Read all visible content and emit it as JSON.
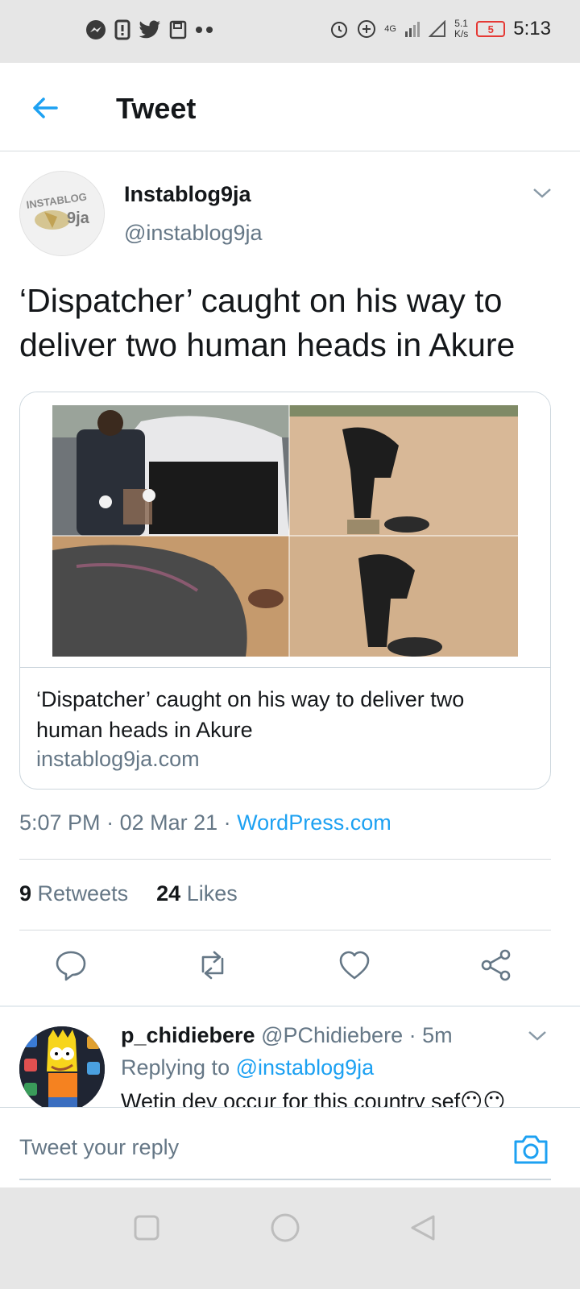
{
  "status_bar": {
    "time": "5:13",
    "speed_value": "5.1",
    "speed_unit": "K/s",
    "network": "4G",
    "battery": "5",
    "left_icons": [
      "messenger-icon",
      "notification-icon",
      "twitter-bird-icon",
      "save-icon",
      "more-dots-icon"
    ],
    "right_icons": [
      "alarm-icon",
      "data-saver-icon",
      "signal-icon",
      "wifi-signal-icon"
    ]
  },
  "header": {
    "title": "Tweet"
  },
  "tweet": {
    "author_name": "Instablog9ja",
    "author_handle": "@instablog9ja",
    "avatar_text": "INSTABLOG 9ja",
    "text": "‘Dispatcher’ caught on his way to deliver two human heads in Akure",
    "card": {
      "title": "‘Dispatcher’ caught on his way to deliver two human heads in Akure",
      "domain": "instablog9ja.com"
    },
    "time": "5:07 PM",
    "date": "02 Mar 21",
    "source": "WordPress.com",
    "retweets_count": "9",
    "retweets_label": "Retweets",
    "likes_count": "24",
    "likes_label": "Likes"
  },
  "reply": {
    "name": "p_chidiebere",
    "handle": "@PChidiebere",
    "age": "5m",
    "replying_prefix": "Replying to",
    "replying_to": "@instablog9ja",
    "text": "Wetin dey occur for this country sef😶😶"
  },
  "compose": {
    "placeholder": "Tweet your reply"
  },
  "colors": {
    "accent": "#1da1f2",
    "muted": "#657786",
    "text": "#14171a",
    "border": "#ccd6dd"
  }
}
